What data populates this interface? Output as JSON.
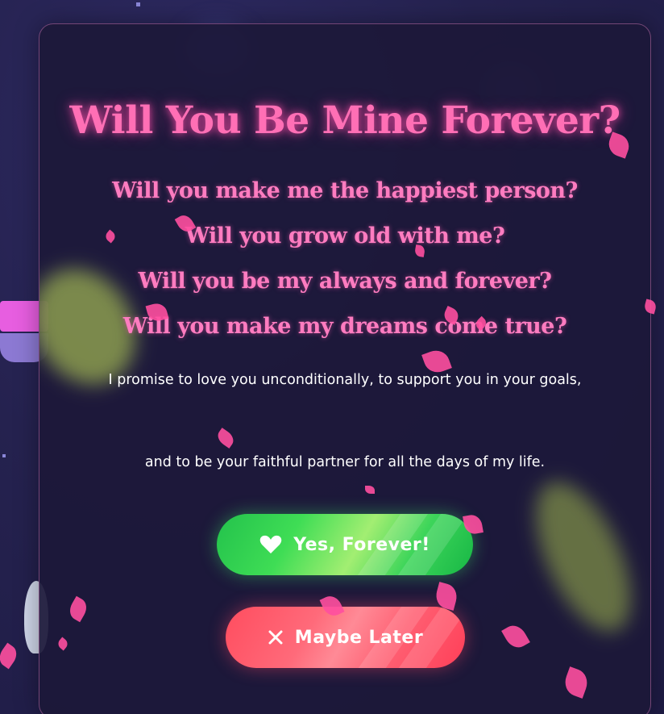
{
  "proposal": {
    "title": "Will You Be Mine Forever?",
    "questions": [
      "Will you make me the happiest person?",
      "Will you grow old with me?",
      "Will you be my always and forever?",
      "Will you make my dreams come true?"
    ],
    "promise_line_1": "I promise to love you unconditionally, to support you in your goals,",
    "promise_line_2": "and to be your faithful partner for all the days of my life."
  },
  "buttons": {
    "yes_label": "Yes, Forever!",
    "yes_icon": "heart-icon",
    "no_label": "Maybe Later",
    "no_icon": "close-icon"
  },
  "colors": {
    "title": "#ff6fb5",
    "questions": "#ff7cc0",
    "yes_button": "#3fdd55",
    "no_button": "#ff4d5f",
    "petals": "#ff4fa0"
  }
}
